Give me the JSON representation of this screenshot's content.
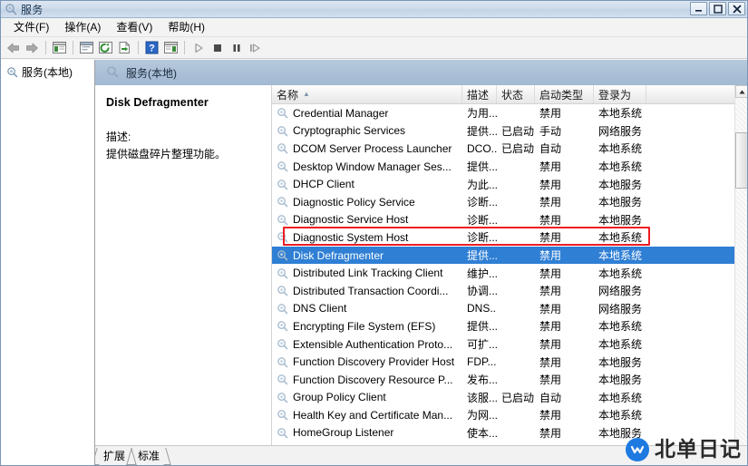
{
  "window": {
    "title": "服务",
    "icon": "services-gear-icon",
    "minimize_label": "最小化",
    "maximize_label": "最大化",
    "close_label": "关闭"
  },
  "menu": {
    "items": [
      {
        "label": "文件(F)",
        "name": "menu-file"
      },
      {
        "label": "操作(A)",
        "name": "menu-action"
      },
      {
        "label": "查看(V)",
        "name": "menu-view"
      },
      {
        "label": "帮助(H)",
        "name": "menu-help"
      }
    ]
  },
  "toolbar": {
    "items": [
      {
        "name": "back-arrow-icon",
        "glyph": "back"
      },
      {
        "name": "forward-arrow-icon",
        "glyph": "forward"
      },
      {
        "name": "separator-1",
        "glyph": "sep"
      },
      {
        "name": "show-hide-tree-icon",
        "glyph": "window-green"
      },
      {
        "name": "separator-2",
        "glyph": "sep"
      },
      {
        "name": "properties-icon",
        "glyph": "window-blue"
      },
      {
        "name": "refresh-icon",
        "glyph": "refresh-green"
      },
      {
        "name": "export-list-icon",
        "glyph": "export-green"
      },
      {
        "name": "separator-3",
        "glyph": "sep"
      },
      {
        "name": "help-icon",
        "glyph": "help-blue"
      },
      {
        "name": "show-action-pane-icon",
        "glyph": "window-green2"
      },
      {
        "name": "separator-4",
        "glyph": "sep"
      },
      {
        "name": "start-service-icon",
        "glyph": "play"
      },
      {
        "name": "stop-service-icon",
        "glyph": "stop"
      },
      {
        "name": "pause-service-icon",
        "glyph": "pause"
      },
      {
        "name": "restart-service-icon",
        "glyph": "restart"
      }
    ]
  },
  "tree": {
    "root_label": "服务(本地)",
    "root_icon": "services-gear-icon"
  },
  "details_header": {
    "label": "服务(本地)",
    "icon": "services-gear-icon"
  },
  "detail": {
    "service_name": "Disk Defragmenter",
    "description_label": "描述:",
    "description_text": "提供磁盘碎片整理功能。"
  },
  "list": {
    "columns": [
      {
        "label": "名称",
        "name": "column-name",
        "sorted": true,
        "sort_arrow": "▲"
      },
      {
        "label": "描述",
        "name": "column-description",
        "sorted": false
      },
      {
        "label": "状态",
        "name": "column-status",
        "sorted": false
      },
      {
        "label": "启动类型",
        "name": "column-startup-type",
        "sorted": false
      },
      {
        "label": "登录为",
        "name": "column-log-on-as",
        "sorted": false
      }
    ],
    "rows": [
      {
        "name": "Credential Manager",
        "description": "为用...",
        "status": "",
        "startup": "禁用",
        "logon": "本地系统",
        "selected": false
      },
      {
        "name": "Cryptographic Services",
        "description": "提供...",
        "status": "已启动",
        "startup": "手动",
        "logon": "网络服务",
        "selected": false
      },
      {
        "name": "DCOM Server Process Launcher",
        "description": "DCO...",
        "status": "已启动",
        "startup": "自动",
        "logon": "本地系统",
        "selected": false
      },
      {
        "name": "Desktop Window Manager Ses...",
        "description": "提供...",
        "status": "",
        "startup": "禁用",
        "logon": "本地系统",
        "selected": false
      },
      {
        "name": "DHCP Client",
        "description": "为此...",
        "status": "",
        "startup": "禁用",
        "logon": "本地服务",
        "selected": false
      },
      {
        "name": "Diagnostic Policy Service",
        "description": "诊断...",
        "status": "",
        "startup": "禁用",
        "logon": "本地服务",
        "selected": false
      },
      {
        "name": "Diagnostic Service Host",
        "description": "诊断...",
        "status": "",
        "startup": "禁用",
        "logon": "本地服务",
        "selected": false
      },
      {
        "name": "Diagnostic System Host",
        "description": "诊断...",
        "status": "",
        "startup": "禁用",
        "logon": "本地系统",
        "selected": false
      },
      {
        "name": "Disk Defragmenter",
        "description": "提供...",
        "status": "",
        "startup": "禁用",
        "logon": "本地系统",
        "selected": true
      },
      {
        "name": "Distributed Link Tracking Client",
        "description": "维护...",
        "status": "",
        "startup": "禁用",
        "logon": "本地系统",
        "selected": false
      },
      {
        "name": "Distributed Transaction Coordi...",
        "description": "协调...",
        "status": "",
        "startup": "禁用",
        "logon": "网络服务",
        "selected": false
      },
      {
        "name": "DNS Client",
        "description": "DNS...",
        "status": "",
        "startup": "禁用",
        "logon": "网络服务",
        "selected": false
      },
      {
        "name": "Encrypting File System (EFS)",
        "description": "提供...",
        "status": "",
        "startup": "禁用",
        "logon": "本地系统",
        "selected": false
      },
      {
        "name": "Extensible Authentication Proto...",
        "description": "可扩...",
        "status": "",
        "startup": "禁用",
        "logon": "本地系统",
        "selected": false
      },
      {
        "name": "Function Discovery Provider Host",
        "description": "FDP...",
        "status": "",
        "startup": "禁用",
        "logon": "本地服务",
        "selected": false
      },
      {
        "name": "Function Discovery Resource P...",
        "description": "发布...",
        "status": "",
        "startup": "禁用",
        "logon": "本地服务",
        "selected": false
      },
      {
        "name": "Group Policy Client",
        "description": "该服...",
        "status": "已启动",
        "startup": "自动",
        "logon": "本地系统",
        "selected": false
      },
      {
        "name": "Health Key and Certificate Man...",
        "description": "为网...",
        "status": "",
        "startup": "禁用",
        "logon": "本地系统",
        "selected": false
      },
      {
        "name": "HomeGroup Listener",
        "description": "使本...",
        "status": "",
        "startup": "禁用",
        "logon": "本地服务",
        "selected": false
      }
    ]
  },
  "tabs": [
    {
      "label": "扩展",
      "name": "tab-extended",
      "active": false
    },
    {
      "label": "标准",
      "name": "tab-standard",
      "active": true
    }
  ],
  "annotation": {
    "color": "#ee1c23",
    "target_row": "Disk Defragmenter"
  },
  "watermark": {
    "text": "北单日记",
    "logo_color": "#1e7ae0"
  },
  "colors": {
    "selection_blue": "#2f7fd4",
    "titlebar_blue": "#c3d3e6",
    "details_header": "#a4bad3",
    "annotation_red": "#ee1c23"
  }
}
